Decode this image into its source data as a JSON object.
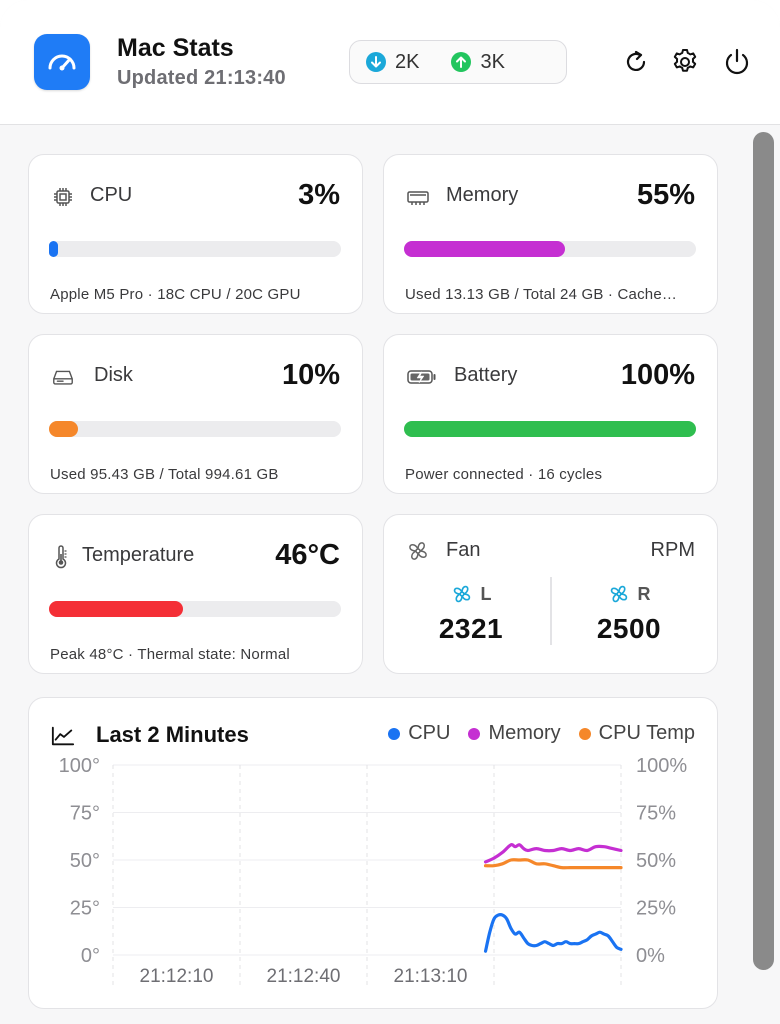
{
  "header": {
    "title": "Mac Stats",
    "updated_prefix": "Updated",
    "updated_time": "21:13:40",
    "download": "2K",
    "upload": "3K",
    "icons": [
      "gauge-icon",
      "refresh-icon",
      "gear-icon",
      "power-icon"
    ]
  },
  "cards": {
    "cpu": {
      "label": "CPU",
      "value": "3%",
      "percent": 3,
      "detail": "Apple M5 Pro · 18C CPU / 20C GPU",
      "color": "#1a73f2"
    },
    "memory": {
      "label": "Memory",
      "value": "55%",
      "percent": 55,
      "detail": "Used 13.13 GB / Total 24 GB · Cache…",
      "color": "#c52fd2"
    },
    "disk": {
      "label": "Disk",
      "value": "10%",
      "percent": 10,
      "detail": "Used 95.43 GB / Total 994.61 GB",
      "color": "#f5872a"
    },
    "battery": {
      "label": "Battery",
      "value": "100%",
      "percent": 100,
      "detail": "Power connected · 16 cycles",
      "color": "#2fbe4f"
    },
    "temperature": {
      "label": "Temperature",
      "value": "46°C",
      "percent": 46,
      "detail": "Peak 48°C · Thermal state: Normal",
      "color": "#f42f36"
    },
    "fan": {
      "label": "Fan",
      "unit": "RPM",
      "left_label": "L",
      "left_rpm": "2321",
      "right_label": "R",
      "right_rpm": "2500",
      "icon_color": "#1ba8d9"
    }
  },
  "chart_data": {
    "type": "line",
    "title": "Last 2 Minutes",
    "legend_placement": "top-right",
    "y_left_ticks": [
      "100°",
      "75°",
      "50°",
      "25°",
      "0°"
    ],
    "y_right_ticks": [
      "100%",
      "75%",
      "50%",
      "25%",
      "0%"
    ],
    "x_ticks": [
      "21:12:10",
      "21:12:40",
      "21:13:10"
    ],
    "ylim": [
      0,
      100
    ],
    "x_range_seconds": [
      -120,
      0
    ],
    "series": [
      {
        "name": "CPU",
        "color": "#1a73f2",
        "x": [
          -32,
          -31,
          -30,
          -29,
          -28,
          -27,
          -26,
          -25,
          -24,
          -23,
          -22,
          -21,
          -20,
          -19,
          -18,
          -17,
          -16,
          -15,
          -14,
          -13,
          -12,
          -11,
          -10,
          -9,
          -8,
          -7,
          -6,
          -5,
          -4,
          -3,
          -2,
          -1,
          0
        ],
        "y": [
          2,
          12,
          19,
          21,
          21,
          19,
          14,
          11,
          12,
          9,
          6,
          5,
          5,
          6,
          7,
          6,
          5,
          6,
          6,
          7,
          6,
          6,
          6,
          7,
          8,
          10,
          11,
          12,
          11,
          10,
          7,
          4,
          3
        ]
      },
      {
        "name": "Memory",
        "color": "#c52fd2",
        "x": [
          -32,
          -30,
          -28,
          -26,
          -25,
          -24,
          -23,
          -22,
          -20,
          -18,
          -16,
          -14,
          -12,
          -10,
          -8,
          -6,
          -4,
          -2,
          0
        ],
        "y": [
          49,
          51,
          54,
          58,
          57,
          58,
          56,
          55,
          56,
          55,
          55,
          56,
          55,
          56,
          55,
          57,
          57,
          56,
          55
        ]
      },
      {
        "name": "CPU Temp",
        "color": "#f5872a",
        "x": [
          -32,
          -30,
          -28,
          -26,
          -24,
          -22,
          -20,
          -18,
          -16,
          -14,
          -12,
          -10,
          -8,
          -6,
          -4,
          -2,
          0
        ],
        "y": [
          47,
          47,
          48,
          50,
          50,
          50,
          48,
          48,
          47,
          46,
          46,
          46,
          46,
          46,
          46,
          46,
          46
        ]
      }
    ]
  }
}
